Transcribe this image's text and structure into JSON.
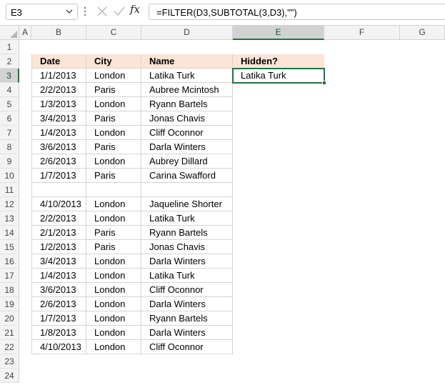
{
  "name_box": {
    "value": "E3"
  },
  "formula_bar": {
    "formula": "=FILTER(D3,SUBTOTAL(3,D3),\"\")",
    "fx_label": "fx"
  },
  "columns": [
    "A",
    "B",
    "C",
    "D",
    "E",
    "F",
    "G"
  ],
  "selected_column": "E",
  "rows": [
    "1",
    "2",
    "3",
    "4",
    "5",
    "6",
    "7",
    "8",
    "9",
    "10",
    "11",
    "12",
    "13",
    "14",
    "15",
    "16",
    "17",
    "18",
    "19",
    "20",
    "21",
    "22",
    "23",
    "24"
  ],
  "selected_row": "3",
  "table": {
    "headers": [
      "Date",
      "City",
      "Name",
      "Hidden?"
    ],
    "rows": [
      {
        "row": "3",
        "date": "1/1/2013",
        "city": "London",
        "name": "Latika Turk"
      },
      {
        "row": "4",
        "date": "2/2/2013",
        "city": "Paris",
        "name": "Aubree Mcintosh"
      },
      {
        "row": "5",
        "date": "1/3/2013",
        "city": "London",
        "name": "Ryann Bartels"
      },
      {
        "row": "6",
        "date": "3/4/2013",
        "city": "Paris",
        "name": "Jonas Chavis"
      },
      {
        "row": "7",
        "date": "1/4/2013",
        "city": "London",
        "name": "Cliff Oconnor"
      },
      {
        "row": "8",
        "date": "3/6/2013",
        "city": "Paris",
        "name": "Darla Winters"
      },
      {
        "row": "9",
        "date": "2/6/2013",
        "city": "London",
        "name": "Aubrey Dillard"
      },
      {
        "row": "10",
        "date": "1/7/2013",
        "city": "Paris",
        "name": "Carina Swafford"
      },
      {
        "row": "11",
        "date": "",
        "city": "",
        "name": ""
      },
      {
        "row": "12",
        "date": "4/10/2013",
        "city": "London",
        "name": "Jaqueline Shorter"
      },
      {
        "row": "13",
        "date": "2/2/2013",
        "city": "London",
        "name": "Latika Turk"
      },
      {
        "row": "14",
        "date": "2/1/2013",
        "city": "Paris",
        "name": "Ryann Bartels"
      },
      {
        "row": "15",
        "date": "1/2/2013",
        "city": "Paris",
        "name": "Jonas Chavis"
      },
      {
        "row": "16",
        "date": "3/4/2013",
        "city": "London",
        "name": "Darla Winters"
      },
      {
        "row": "17",
        "date": "1/4/2013",
        "city": "London",
        "name": "Latika Turk"
      },
      {
        "row": "18",
        "date": "3/6/2013",
        "city": "London",
        "name": "Cliff Oconnor"
      },
      {
        "row": "19",
        "date": "2/6/2013",
        "city": "London",
        "name": "Darla Winters"
      },
      {
        "row": "20",
        "date": "1/7/2013",
        "city": "London",
        "name": "Ryann Bartels"
      },
      {
        "row": "21",
        "date": "1/8/2013",
        "city": "London",
        "name": "Darla Winters"
      },
      {
        "row": "22",
        "date": "4/10/2013",
        "city": "London",
        "name": "Cliff Oconnor"
      }
    ]
  },
  "result_cell": {
    "ref": "E3",
    "value": "Latika Turk"
  },
  "colors": {
    "header_fill": "#fce4d6",
    "accent": "#217346"
  }
}
